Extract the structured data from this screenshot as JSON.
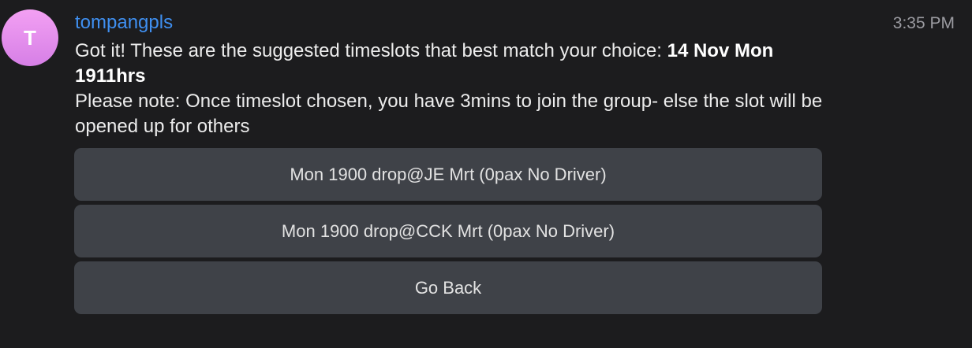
{
  "message": {
    "avatar_letter": "T",
    "sender": "tompangpls",
    "time": "3:35 PM",
    "line1_prefix": "Got it! These are the suggested timeslots that best match your choice: ",
    "line1_bold": "14 Nov Mon 1911hrs",
    "line2": "Please note: Once timeslot chosen, you have 3mins to join the group- else the slot will be opened up for others"
  },
  "buttons": [
    {
      "label": "Mon 1900 drop@JE Mrt (0pax No Driver)"
    },
    {
      "label": "Mon 1900 drop@CCK Mrt (0pax No Driver)"
    },
    {
      "label": "Go Back"
    }
  ],
  "colors": {
    "background": "#1c1c1e",
    "sender_name": "#3f8ff0",
    "button_bg": "#3f4248",
    "avatar_gradient_top": "#f3a0f3",
    "avatar_gradient_bottom": "#d67fe6"
  }
}
